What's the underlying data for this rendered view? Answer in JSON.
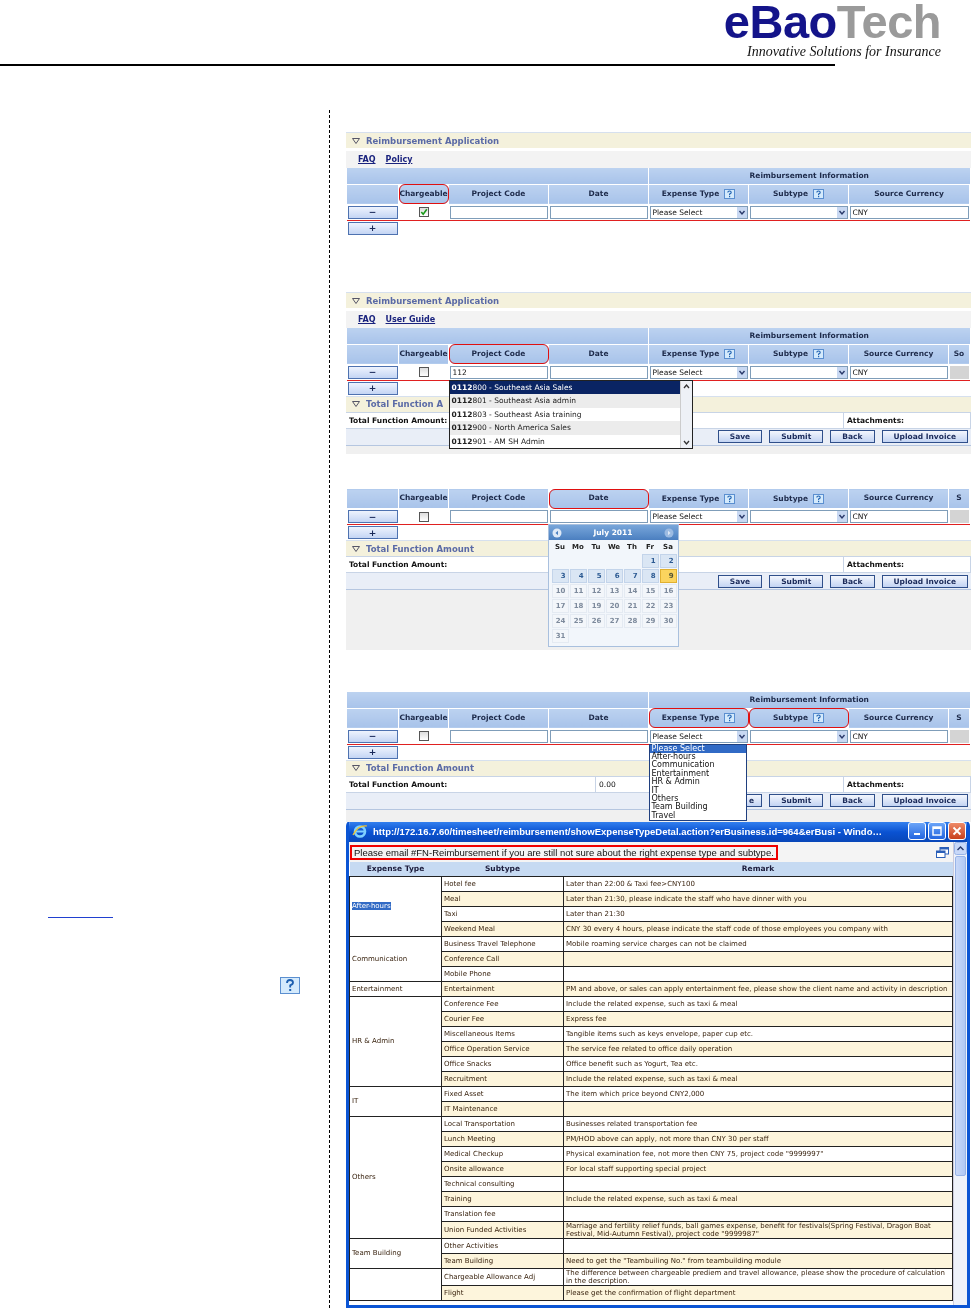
{
  "header": {
    "logo_primary": "eBao",
    "logo_secondary": "Tech",
    "tagline": "Innovative Solutions for Insurance"
  },
  "panels": [
    {
      "title": "Reimbursement Application",
      "links": [
        "FAQ",
        "Policy"
      ],
      "group_header": "Reimbursement Information",
      "columns": [
        {
          "label": "Chargeable",
          "help": false,
          "highlighted": true
        },
        {
          "label": "Project Code",
          "help": false,
          "highlighted": false
        },
        {
          "label": "Date",
          "help": false,
          "highlighted": false
        },
        {
          "label": "Expense Type",
          "help": true,
          "highlighted": false
        },
        {
          "label": "Subtype",
          "help": true,
          "highlighted": false
        },
        {
          "label": "Source Currency",
          "help": false,
          "highlighted": false
        }
      ],
      "row": {
        "chargeable": true,
        "expense_type": "Please Select",
        "source_currency": "CNY"
      },
      "row_buttons": {
        "remove": "−",
        "add": "+"
      }
    },
    {
      "title": "Reimbursement Application",
      "links": [
        "FAQ",
        "User Guide"
      ],
      "group_header": "Reimbursement Information",
      "columns": [
        {
          "label": "Chargeable",
          "help": false,
          "highlighted": false
        },
        {
          "label": "Project Code",
          "help": false,
          "highlighted": true
        },
        {
          "label": "Date",
          "help": false,
          "highlighted": false
        },
        {
          "label": "Expense Type",
          "help": true,
          "highlighted": false
        },
        {
          "label": "Subtype",
          "help": true,
          "highlighted": false
        },
        {
          "label": "Source Currency",
          "help": false,
          "highlighted": false
        },
        {
          "label": "So",
          "help": false,
          "highlighted": false
        }
      ],
      "row": {
        "chargeable": false,
        "project_code": "112",
        "expense_type": "Please Select",
        "source_currency": "CNY"
      },
      "row_buttons": {
        "remove": "−",
        "add": "+"
      },
      "total": {
        "title": "Total Function A",
        "label": "Total Function Amount:",
        "attachments_label": "Attachments:"
      },
      "buttons": [
        {
          "label": "Save",
          "covered": false
        },
        {
          "label": "Submit",
          "covered": false
        },
        {
          "label": "Back",
          "covered": false
        },
        {
          "label": "Upload Invoice",
          "covered": false
        }
      ],
      "overlay": {
        "kind": "autocomplete",
        "items": [
          {
            "text": "**0112**800 - Southeast Asia Sales",
            "selected": true
          },
          {
            "text": "**0112**801 - Southeast Asia admin",
            "selected": false
          },
          {
            "text": "**0112**803 - Southeast Asia training",
            "selected": false
          },
          {
            "text": "**0112**900 - North America Sales",
            "selected": false
          },
          {
            "text": "**0112**901 - AM SH Admin",
            "selected": false
          }
        ]
      }
    },
    {
      "columns": [
        {
          "label": "Chargeable",
          "help": false,
          "highlighted": false
        },
        {
          "label": "Project Code",
          "help": false,
          "highlighted": false
        },
        {
          "label": "Date",
          "help": false,
          "highlighted": true
        },
        {
          "label": "Expense Type",
          "help": true,
          "highlighted": false
        },
        {
          "label": "Subtype",
          "help": true,
          "highlighted": false
        },
        {
          "label": "Source Currency",
          "help": false,
          "highlighted": false
        },
        {
          "label": "S",
          "help": false,
          "highlighted": false
        }
      ],
      "row": {
        "chargeable": false,
        "expense_type": "Please Select",
        "source_currency": "CNY"
      },
      "row_buttons": {
        "remove": "−",
        "add": "+"
      },
      "total": {
        "title": "Total Function Amount",
        "label": "Total Function Amount:",
        "attachments_label": "Attachments:"
      },
      "buttons": [
        {
          "label": "Save",
          "covered": false
        },
        {
          "label": "Submit",
          "covered": false
        },
        {
          "label": "Back",
          "covered": false
        },
        {
          "label": "Upload Invoice",
          "covered": false
        }
      ],
      "overlay": {
        "kind": "calendar",
        "title": "July 2011",
        "weekdays": [
          "Su",
          "Mo",
          "Tu",
          "We",
          "Th",
          "Fr",
          "Sa"
        ],
        "days": [
          {
            "kind": "blank"
          },
          {
            "kind": "blank"
          },
          {
            "kind": "blank"
          },
          {
            "kind": "blank"
          },
          {
            "kind": "blank"
          },
          {
            "kind": "day",
            "label": "1",
            "disabled": false,
            "selected": false
          },
          {
            "kind": "day",
            "label": "2",
            "disabled": false,
            "selected": false
          },
          {
            "kind": "day",
            "label": "3",
            "disabled": false,
            "selected": false
          },
          {
            "kind": "day",
            "label": "4",
            "disabled": false,
            "selected": false
          },
          {
            "kind": "day",
            "label": "5",
            "disabled": false,
            "selected": false
          },
          {
            "kind": "day",
            "label": "6",
            "disabled": false,
            "selected": false
          },
          {
            "kind": "day",
            "label": "7",
            "disabled": false,
            "selected": false
          },
          {
            "kind": "day",
            "label": "8",
            "disabled": false,
            "selected": false
          },
          {
            "kind": "day",
            "label": "9",
            "disabled": false,
            "selected": true
          },
          {
            "kind": "day",
            "label": "10",
            "disabled": true,
            "selected": false
          },
          {
            "kind": "day",
            "label": "11",
            "disabled": true,
            "selected": false
          },
          {
            "kind": "day",
            "label": "12",
            "disabled": true,
            "selected": false
          },
          {
            "kind": "day",
            "label": "13",
            "disabled": true,
            "selected": false
          },
          {
            "kind": "day",
            "label": "14",
            "disabled": true,
            "selected": false
          },
          {
            "kind": "day",
            "label": "15",
            "disabled": true,
            "selected": false
          },
          {
            "kind": "day",
            "label": "16",
            "disabled": true,
            "selected": false
          },
          {
            "kind": "day",
            "label": "17",
            "disabled": true,
            "selected": false
          },
          {
            "kind": "day",
            "label": "18",
            "disabled": true,
            "selected": false
          },
          {
            "kind": "day",
            "label": "19",
            "disabled": true,
            "selected": false
          },
          {
            "kind": "day",
            "label": "20",
            "disabled": true,
            "selected": false
          },
          {
            "kind": "day",
            "label": "21",
            "disabled": true,
            "selected": false
          },
          {
            "kind": "day",
            "label": "22",
            "disabled": true,
            "selected": false
          },
          {
            "kind": "day",
            "label": "23",
            "disabled": true,
            "selected": false
          },
          {
            "kind": "day",
            "label": "24",
            "disabled": true,
            "selected": false
          },
          {
            "kind": "day",
            "label": "25",
            "disabled": true,
            "selected": false
          },
          {
            "kind": "day",
            "label": "26",
            "disabled": true,
            "selected": false
          },
          {
            "kind": "day",
            "label": "27",
            "disabled": true,
            "selected": false
          },
          {
            "kind": "day",
            "label": "28",
            "disabled": true,
            "selected": false
          },
          {
            "kind": "day",
            "label": "29",
            "disabled": true,
            "selected": false
          },
          {
            "kind": "day",
            "label": "30",
            "disabled": true,
            "selected": false
          },
          {
            "kind": "day",
            "label": "31",
            "disabled": true,
            "selected": false
          }
        ]
      }
    },
    {
      "group_header": "Reimbursement Information",
      "columns": [
        {
          "label": "Chargeable",
          "help": false,
          "highlighted": false
        },
        {
          "label": "Project Code",
          "help": false,
          "highlighted": false
        },
        {
          "label": "Date",
          "help": false,
          "highlighted": false
        },
        {
          "label": "Expense Type",
          "help": true,
          "highlighted": true
        },
        {
          "label": "Subtype",
          "help": true,
          "highlighted": true
        },
        {
          "label": "Source Currency",
          "help": false,
          "highlighted": false
        },
        {
          "label": "S",
          "help": false,
          "highlighted": false
        }
      ],
      "row": {
        "chargeable": false,
        "expense_type": "Please Select",
        "source_currency": "CNY"
      },
      "row_buttons": {
        "remove": "−",
        "add": "+"
      },
      "total": {
        "title": "Total Function Amount",
        "label": "Total Function Amount:",
        "value": "0.00",
        "attachments_label": "Attachments:"
      },
      "buttons": [
        {
          "label": "e",
          "covered": true
        },
        {
          "label": "Submit",
          "covered": false
        },
        {
          "label": "Back",
          "covered": false
        },
        {
          "label": "Upload Invoice",
          "covered": false
        }
      ],
      "overlay": {
        "kind": "select_list",
        "options": [
          {
            "label": "Please Select",
            "selected": true
          },
          {
            "label": "After-hours",
            "selected": false
          },
          {
            "label": "Communication",
            "selected": false
          },
          {
            "label": "Entertainment",
            "selected": false
          },
          {
            "label": "HR & Admin",
            "selected": false
          },
          {
            "label": "IT",
            "selected": false
          },
          {
            "label": "Others",
            "selected": false
          },
          {
            "label": "Team Building",
            "selected": false
          },
          {
            "label": "Travel",
            "selected": false
          }
        ]
      }
    }
  ],
  "window": {
    "title": "http://172.16.7.60/timesheet/reimbursement/showExpenseTypeDetal.action?erBusiness.id=964&erBusi - Windo…",
    "message": "Please email #FN-Reimbursement if you are still not sure about the right expense type and subtype.",
    "columns": [
      "Expense Type",
      "Subtype",
      "Remark"
    ],
    "groups": [
      {
        "expense_type": "After-hours",
        "selected": true,
        "items": [
          {
            "subtype": "Hotel fee",
            "remark": "Later than 22:00 & Taxi fee>CNY100"
          },
          {
            "subtype": "Meal",
            "remark": "Later than 21:30, please indicate the staff who have dinner with you"
          },
          {
            "subtype": "Taxi",
            "remark": "Later than 21:30"
          },
          {
            "subtype": "Weekend Meal",
            "remark": "CNY 30 every 4 hours, please indicate the staff code of those employees you company with"
          }
        ]
      },
      {
        "expense_type": "Communication",
        "selected": false,
        "items": [
          {
            "subtype": "Business Travel Telephone",
            "remark": "Mobile roaming service charges can not be claimed"
          },
          {
            "subtype": "Conference Call"
          },
          {
            "subtype": "Mobile Phone"
          }
        ]
      },
      {
        "expense_type": "Entertainment",
        "selected": false,
        "items": [
          {
            "subtype": "Entertainment",
            "remark": "PM and above, or sales can apply entertainment fee, please show the client name and activity in description"
          }
        ]
      },
      {
        "expense_type": "HR & Admin",
        "selected": false,
        "items": [
          {
            "subtype": "Conference Fee",
            "remark": "Include the related expense, such as taxi & meal"
          },
          {
            "subtype": "Courier Fee",
            "remark": "Express fee"
          },
          {
            "subtype": "Miscellaneous Items",
            "remark": "Tangible items such as keys envelope, paper cup etc."
          },
          {
            "subtype": "Office Operation Service",
            "remark": "The service fee related to office daily operation"
          },
          {
            "subtype": "Office Snacks",
            "remark": "Office benefit such as Yogurt, Tea etc."
          },
          {
            "subtype": "Recruitment",
            "remark": "Include the related expense, such as taxi & meal"
          }
        ]
      },
      {
        "expense_type": "IT",
        "selected": false,
        "items": [
          {
            "subtype": "Fixed Asset",
            "remark": "The item which price beyond CNY2,000"
          },
          {
            "subtype": "IT Maintenance"
          }
        ]
      },
      {
        "expense_type": "Others",
        "selected": false,
        "items": [
          {
            "subtype": "Local Transportation",
            "remark": "Businesses related transportation fee"
          },
          {
            "subtype": "Lunch Meeting",
            "remark": "PM/HOD above can apply, not more than CNY 30 per staff"
          },
          {
            "subtype": "Medical Checkup",
            "remark": "Physical examination fee, not more then CNY 75, project code \"9999997\""
          },
          {
            "subtype": "Onsite allowance",
            "remark": "For local staff supporting special project"
          },
          {
            "subtype": "Technical consulting"
          },
          {
            "subtype": "Training",
            "remark": "Include the related expense, such as taxi & meal"
          },
          {
            "subtype": "Translation fee"
          },
          {
            "subtype": "Union Funded Activities",
            "remark": "Marriage and fertility relief funds, ball games expense, benefit for festivals(Spring Festival, Dragon Boat Festival, Mid-Autumn Festival), project code \"9999987\""
          }
        ]
      },
      {
        "expense_type": "Team Building",
        "selected": false,
        "items": [
          {
            "subtype": "Other Activities"
          },
          {
            "subtype": "Team Building",
            "remark": "Need to get the \"Teambuiling No.\" from teambuilding module"
          }
        ]
      },
      {
        "items": [
          {
            "subtype": "Chargeable Allowance Adj",
            "remark": "The difference between chargeable prediem and travel allowance, please show the procedure of calculation in the description."
          },
          {
            "subtype": "Flight",
            "remark": "Please get the confirmation of flight department"
          }
        ]
      }
    ]
  }
}
